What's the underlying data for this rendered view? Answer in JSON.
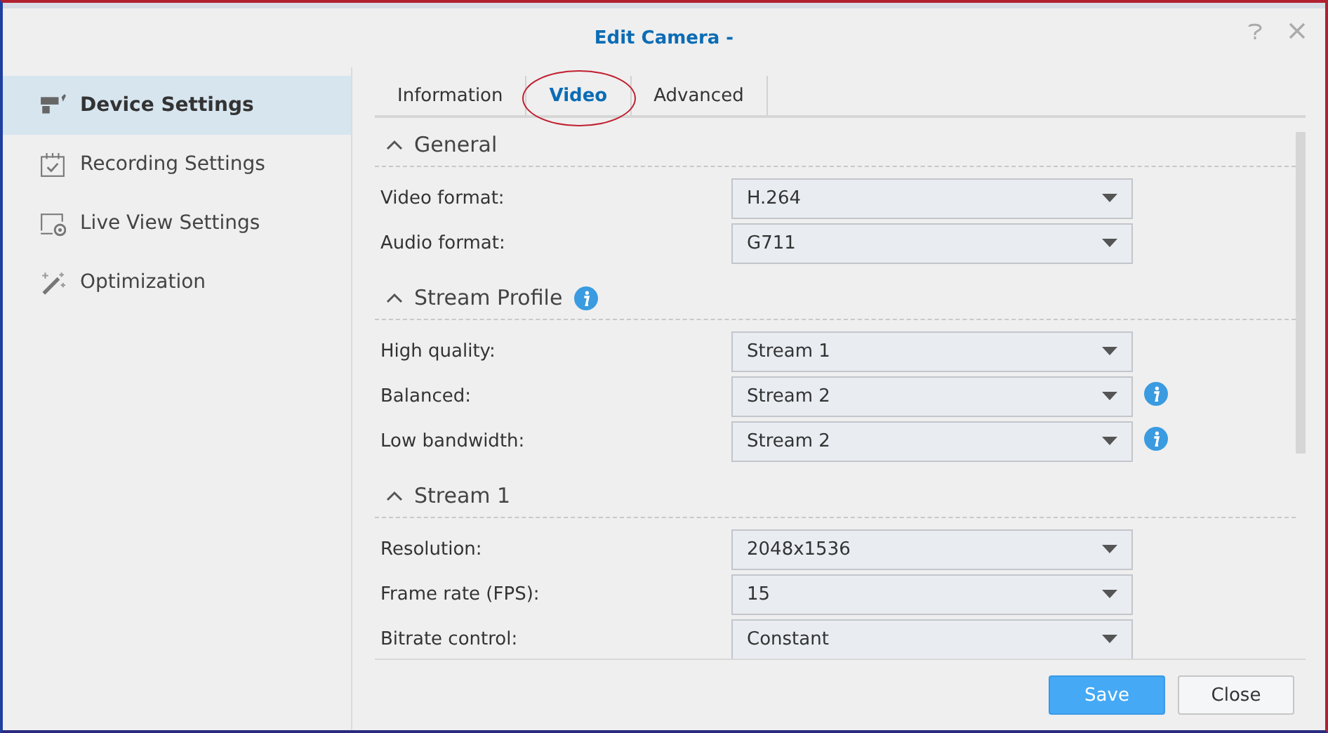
{
  "window": {
    "title": "Edit Camera -"
  },
  "sidebar": {
    "items": [
      {
        "label": "Device Settings",
        "selected": true
      },
      {
        "label": "Recording Settings",
        "selected": false
      },
      {
        "label": "Live View Settings",
        "selected": false
      },
      {
        "label": "Optimization",
        "selected": false
      }
    ]
  },
  "tabs": [
    {
      "label": "Information",
      "selected": false
    },
    {
      "label": "Video",
      "selected": true
    },
    {
      "label": "Advanced",
      "selected": false
    }
  ],
  "sections": [
    {
      "title": "General",
      "expanded": true,
      "info": false,
      "fields": [
        {
          "label": "Video format:",
          "value": "H.264",
          "info": false
        },
        {
          "label": "Audio format:",
          "value": "G711",
          "info": false
        }
      ]
    },
    {
      "title": "Stream Profile",
      "expanded": true,
      "info": true,
      "fields": [
        {
          "label": "High quality:",
          "value": "Stream 1",
          "info": false
        },
        {
          "label": "Balanced:",
          "value": "Stream 2",
          "info": true
        },
        {
          "label": "Low bandwidth:",
          "value": "Stream 2",
          "info": true
        }
      ]
    },
    {
      "title": "Stream 1",
      "expanded": true,
      "info": false,
      "fields": [
        {
          "label": "Resolution:",
          "value": "2048x1536",
          "info": false
        },
        {
          "label": "Frame rate (FPS):",
          "value": "15",
          "info": false
        },
        {
          "label": "Bitrate control:",
          "value": "Constant",
          "info": false
        }
      ]
    }
  ],
  "buttons": [
    {
      "label": "Save",
      "kind": "primary"
    },
    {
      "label": "Close",
      "kind": "secondary"
    }
  ]
}
